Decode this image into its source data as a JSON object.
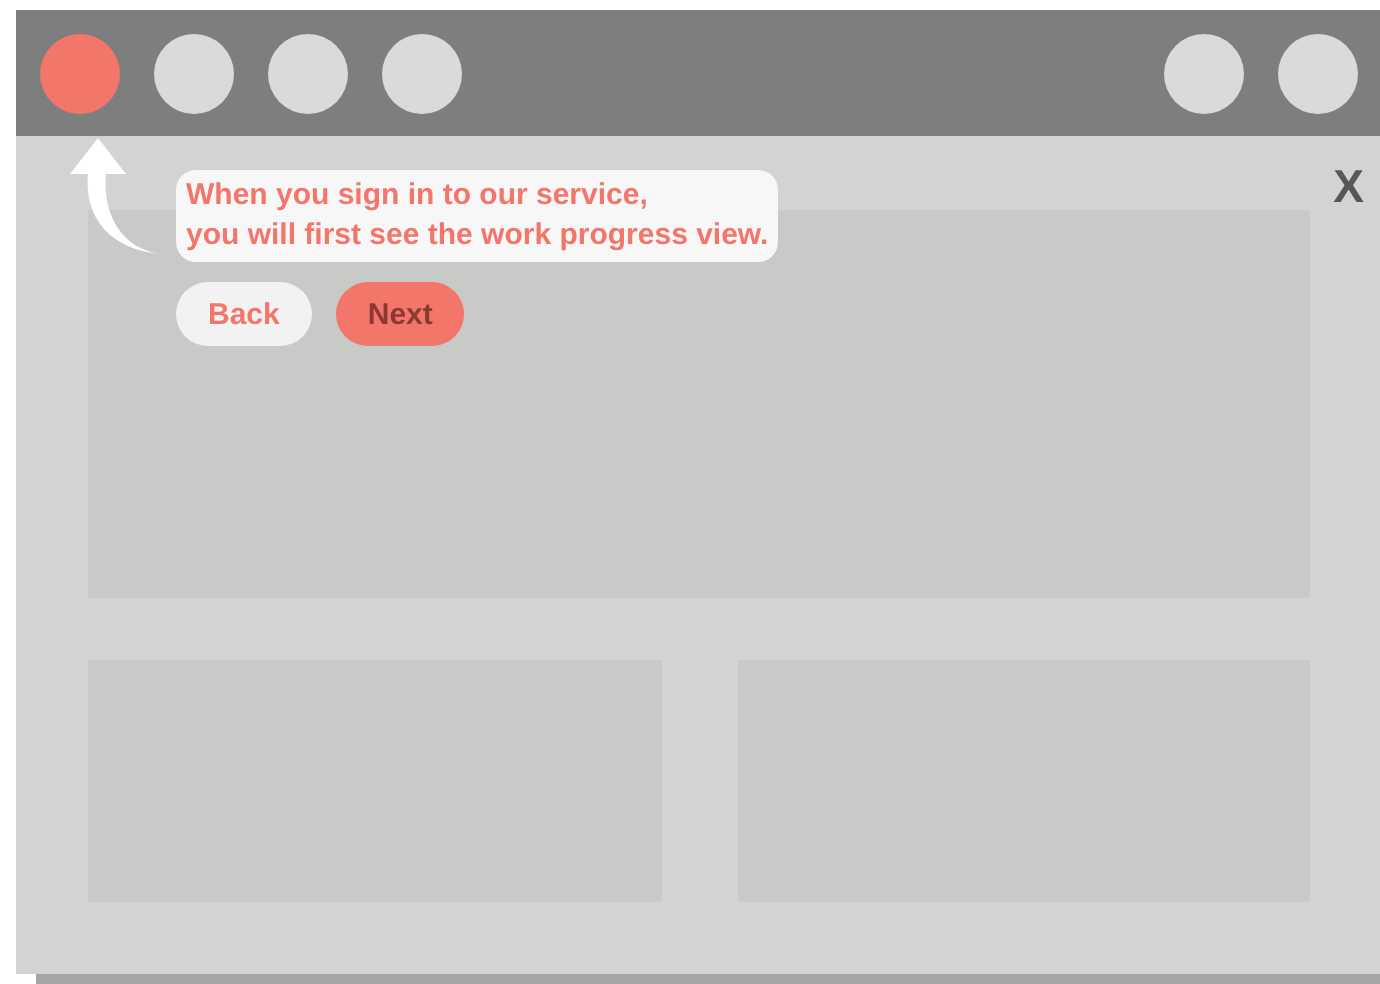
{
  "window": {
    "title_bar": {
      "left_controls": [
        {
          "highlighted": true
        },
        {
          "highlighted": false
        },
        {
          "highlighted": false
        },
        {
          "highlighted": false
        }
      ],
      "right_controls": [
        {
          "highlighted": false
        },
        {
          "highlighted": false
        }
      ]
    },
    "close": "X"
  },
  "tour_tip": {
    "message": "When you sign in to our service,\nyou will first see the work progress view.",
    "buttons": [
      {
        "label": "Back",
        "kind": "secondary"
      },
      {
        "label": "Next",
        "kind": "primary"
      }
    ]
  }
}
